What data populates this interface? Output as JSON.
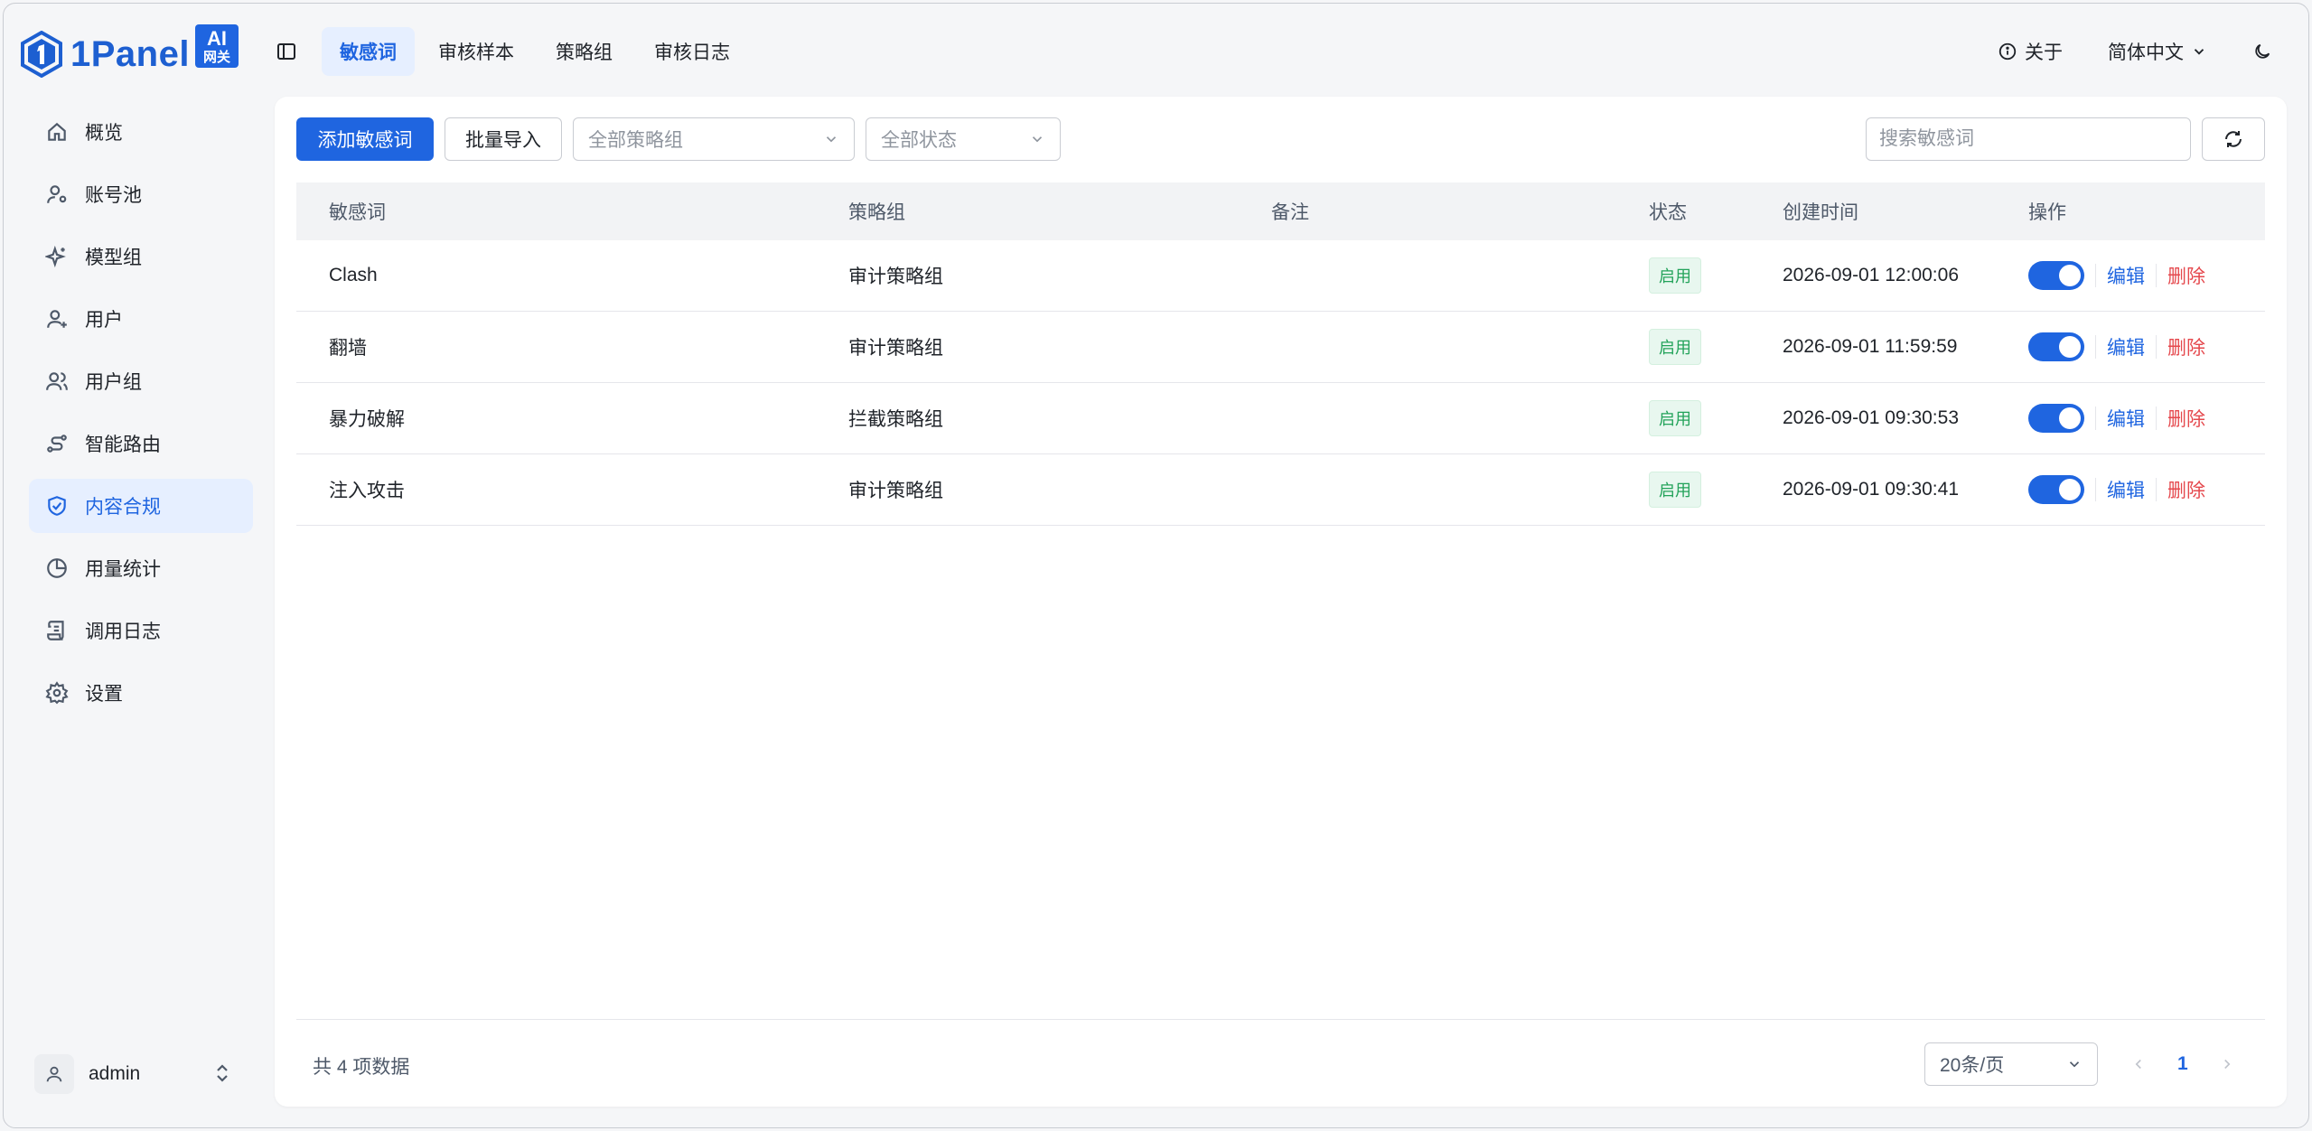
{
  "brand": {
    "name": "1Panel",
    "badge_top": "AI",
    "badge_bottom": "网关"
  },
  "top_tabs": [
    {
      "label": "敏感词",
      "active": true
    },
    {
      "label": "审核样本",
      "active": false
    },
    {
      "label": "策略组",
      "active": false
    },
    {
      "label": "审核日志",
      "active": false
    }
  ],
  "top_right": {
    "about": "关于",
    "language": "简体中文"
  },
  "sidebar": {
    "items": [
      {
        "label": "概览",
        "icon": "home-icon"
      },
      {
        "label": "账号池",
        "icon": "user-gear-icon"
      },
      {
        "label": "模型组",
        "icon": "sparkles-icon"
      },
      {
        "label": "用户",
        "icon": "user-plus-icon"
      },
      {
        "label": "用户组",
        "icon": "users-icon"
      },
      {
        "label": "智能路由",
        "icon": "route-icon"
      },
      {
        "label": "内容合规",
        "icon": "shield-check-icon",
        "active": true
      },
      {
        "label": "用量统计",
        "icon": "pie-chart-icon"
      },
      {
        "label": "调用日志",
        "icon": "scroll-icon"
      },
      {
        "label": "设置",
        "icon": "gear-icon"
      }
    ],
    "user": "admin"
  },
  "toolbar": {
    "add_label": "添加敏感词",
    "import_label": "批量导入",
    "policy_filter": "全部策略组",
    "status_filter": "全部状态",
    "search_placeholder": "搜索敏感词"
  },
  "table": {
    "headers": {
      "word": "敏感词",
      "policy": "策略组",
      "note": "备注",
      "status": "状态",
      "created": "创建时间",
      "ops": "操作"
    },
    "rows": [
      {
        "word": "Clash",
        "policy": "审计策略组",
        "note": "",
        "status": "启用",
        "created": "2026-09-01 12:00:06",
        "enabled": true,
        "edit": "编辑",
        "delete": "删除"
      },
      {
        "word": "翻墙",
        "policy": "审计策略组",
        "note": "",
        "status": "启用",
        "created": "2026-09-01 11:59:59",
        "enabled": true,
        "edit": "编辑",
        "delete": "删除"
      },
      {
        "word": "暴力破解",
        "policy": "拦截策略组",
        "note": "",
        "status": "启用",
        "created": "2026-09-01 09:30:53",
        "enabled": true,
        "edit": "编辑",
        "delete": "删除"
      },
      {
        "word": "注入攻击",
        "policy": "审计策略组",
        "note": "",
        "status": "启用",
        "created": "2026-09-01 09:30:41",
        "enabled": true,
        "edit": "编辑",
        "delete": "删除"
      }
    ]
  },
  "footer": {
    "total": "共 4 项数据",
    "page_size": "20条/页",
    "current_page": "1"
  },
  "colors": {
    "accent": "#1f65e0",
    "success": "#23a35a",
    "danger": "#e5484d"
  }
}
